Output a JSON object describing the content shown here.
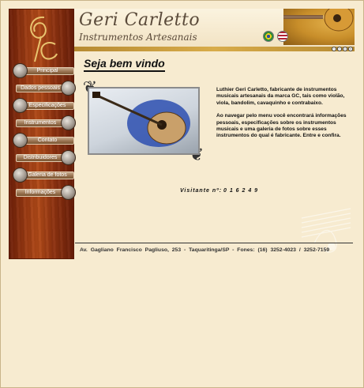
{
  "header": {
    "title": "Geri Carletto",
    "subtitle": "Instrumentos Artesanais",
    "flags": [
      {
        "name": "brazil-flag",
        "color": "#2e8b3a"
      },
      {
        "name": "usa-flag",
        "color": "#b22234"
      }
    ]
  },
  "sidebar": {
    "logo_text": "GC",
    "items": [
      {
        "label": "Principal",
        "icon": "guitar-icon"
      },
      {
        "label": "Dados pessoais",
        "icon": "portrait-icon"
      },
      {
        "label": "Especificações",
        "icon": "guitar-icon"
      },
      {
        "label": "Instrumentos",
        "icon": "guitar-icon"
      },
      {
        "label": "Contato",
        "icon": "envelope-icon"
      },
      {
        "label": "Distribuidores",
        "icon": "guitar-icon"
      },
      {
        "label": "Galeria de fotos",
        "icon": "camera-icon"
      },
      {
        "label": "Informações",
        "icon": "info-icon"
      }
    ]
  },
  "main": {
    "welcome": "Seja bem vindo",
    "intro_p1": "Luthier Geri Carletto, fabricante de instrumentos musicais artesanais da marca GC, tais como violão, viola, bandolim, cavaquinho e contrabaixo.",
    "intro_p2": "Ao navegar pelo menu você encontrará informações pessoais, especificações sobre os instrumentos musicais e uma galeria de fotos sobre esses instrumentos do qual é fabricante. Entre e confira.",
    "visitor_label": "Visitante nº:",
    "visitor_count": "0 1 6 2 4 9"
  },
  "footer": {
    "address": "Av. Gagliano Francisco Pagliuso, 253 - Taquaritinga/SP - Fones: (16) 3252-4023 / 3252-7159"
  },
  "colors": {
    "page_bg": "#f7ebd0",
    "wood": "#9a3a12",
    "accent_gold": "#d8ac4a"
  }
}
